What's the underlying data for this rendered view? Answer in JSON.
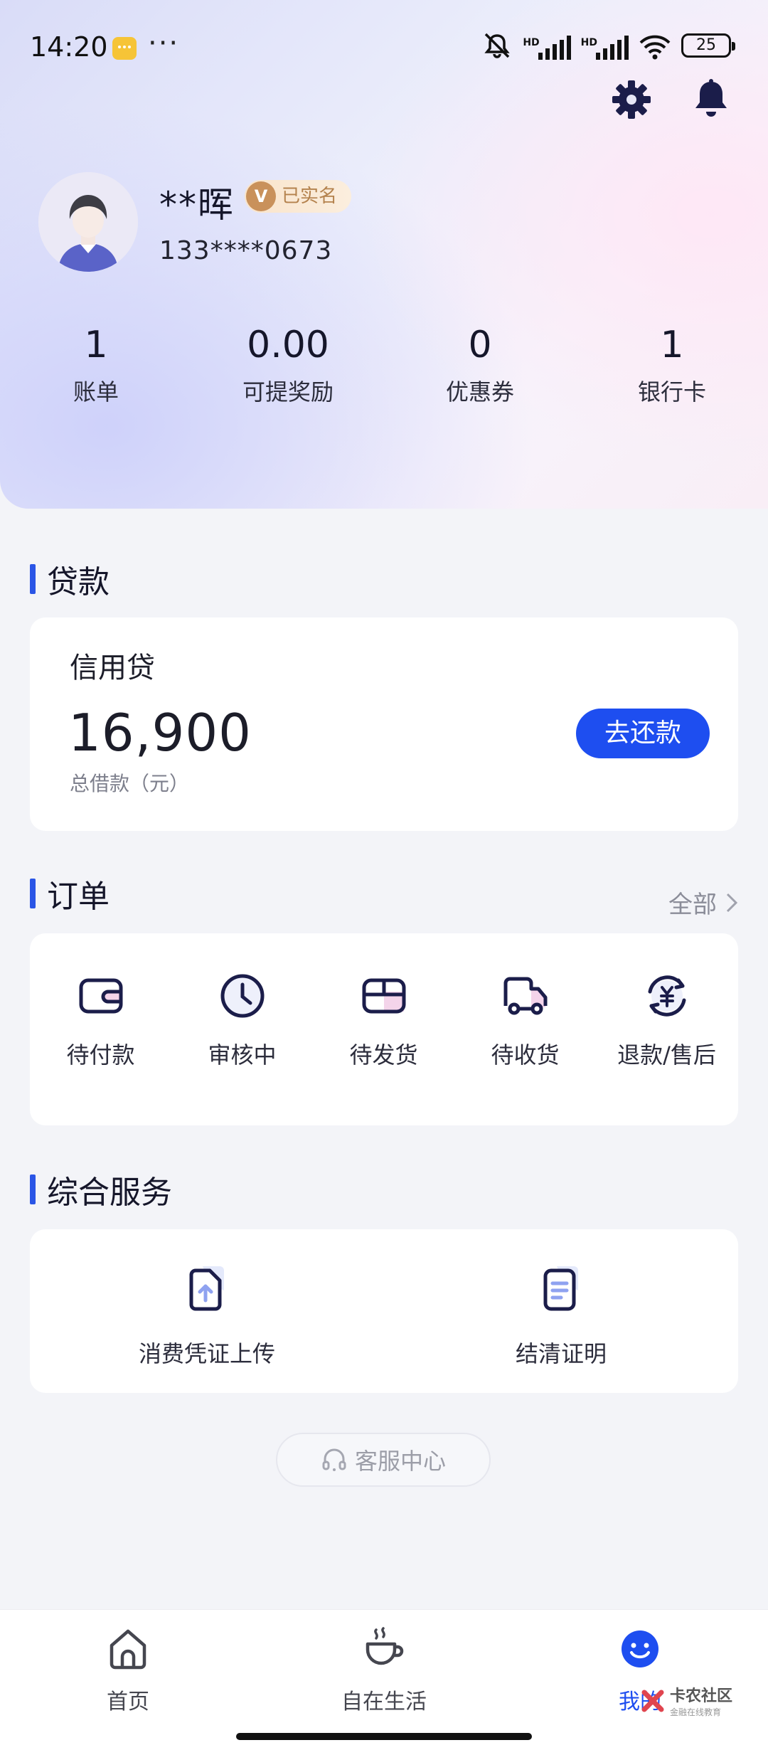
{
  "status_bar": {
    "time": "14:20",
    "dots": "···",
    "hd1": "HD",
    "hd2": "HD",
    "battery": "25"
  },
  "profile": {
    "name": "**晖",
    "verified_badge": "已实名",
    "verified_icon_letter": "V",
    "phone": "133****0673"
  },
  "stats": [
    {
      "value": "1",
      "label": "账单"
    },
    {
      "value": "0.00",
      "label": "可提奖励"
    },
    {
      "value": "0",
      "label": "优惠券"
    },
    {
      "value": "1",
      "label": "银行卡"
    }
  ],
  "loan": {
    "section_title": "贷款",
    "type": "信用贷",
    "amount": "16,900",
    "amount_caption": "总借款（元）",
    "repay_button": "去还款"
  },
  "orders": {
    "section_title": "订单",
    "see_all": "全部",
    "items": [
      {
        "label": "待付款",
        "icon": "wallet-icon"
      },
      {
        "label": "审核中",
        "icon": "clock-icon"
      },
      {
        "label": "待发货",
        "icon": "package-icon"
      },
      {
        "label": "待收货",
        "icon": "truck-icon"
      },
      {
        "label": "退款/售后",
        "icon": "refund-icon"
      }
    ]
  },
  "services": {
    "section_title": "综合服务",
    "items": [
      {
        "label": "消费凭证上传",
        "icon": "upload-document-icon"
      },
      {
        "label": "结清证明",
        "icon": "certificate-document-icon"
      }
    ]
  },
  "customer_service": {
    "label": "客服中心"
  },
  "bottom_nav": [
    {
      "label": "首页",
      "icon": "home-icon",
      "active": false
    },
    {
      "label": "自在生活",
      "icon": "coffee-cup-icon",
      "active": false
    },
    {
      "label": "我的",
      "icon": "smiley-icon",
      "active": true
    }
  ],
  "watermark": {
    "main": "卡农社区",
    "sub": "金融在线教育"
  },
  "colors": {
    "accent": "#1e4ef0",
    "section_bar": "#2a55e6",
    "icon_dark": "#1b1d4a"
  }
}
